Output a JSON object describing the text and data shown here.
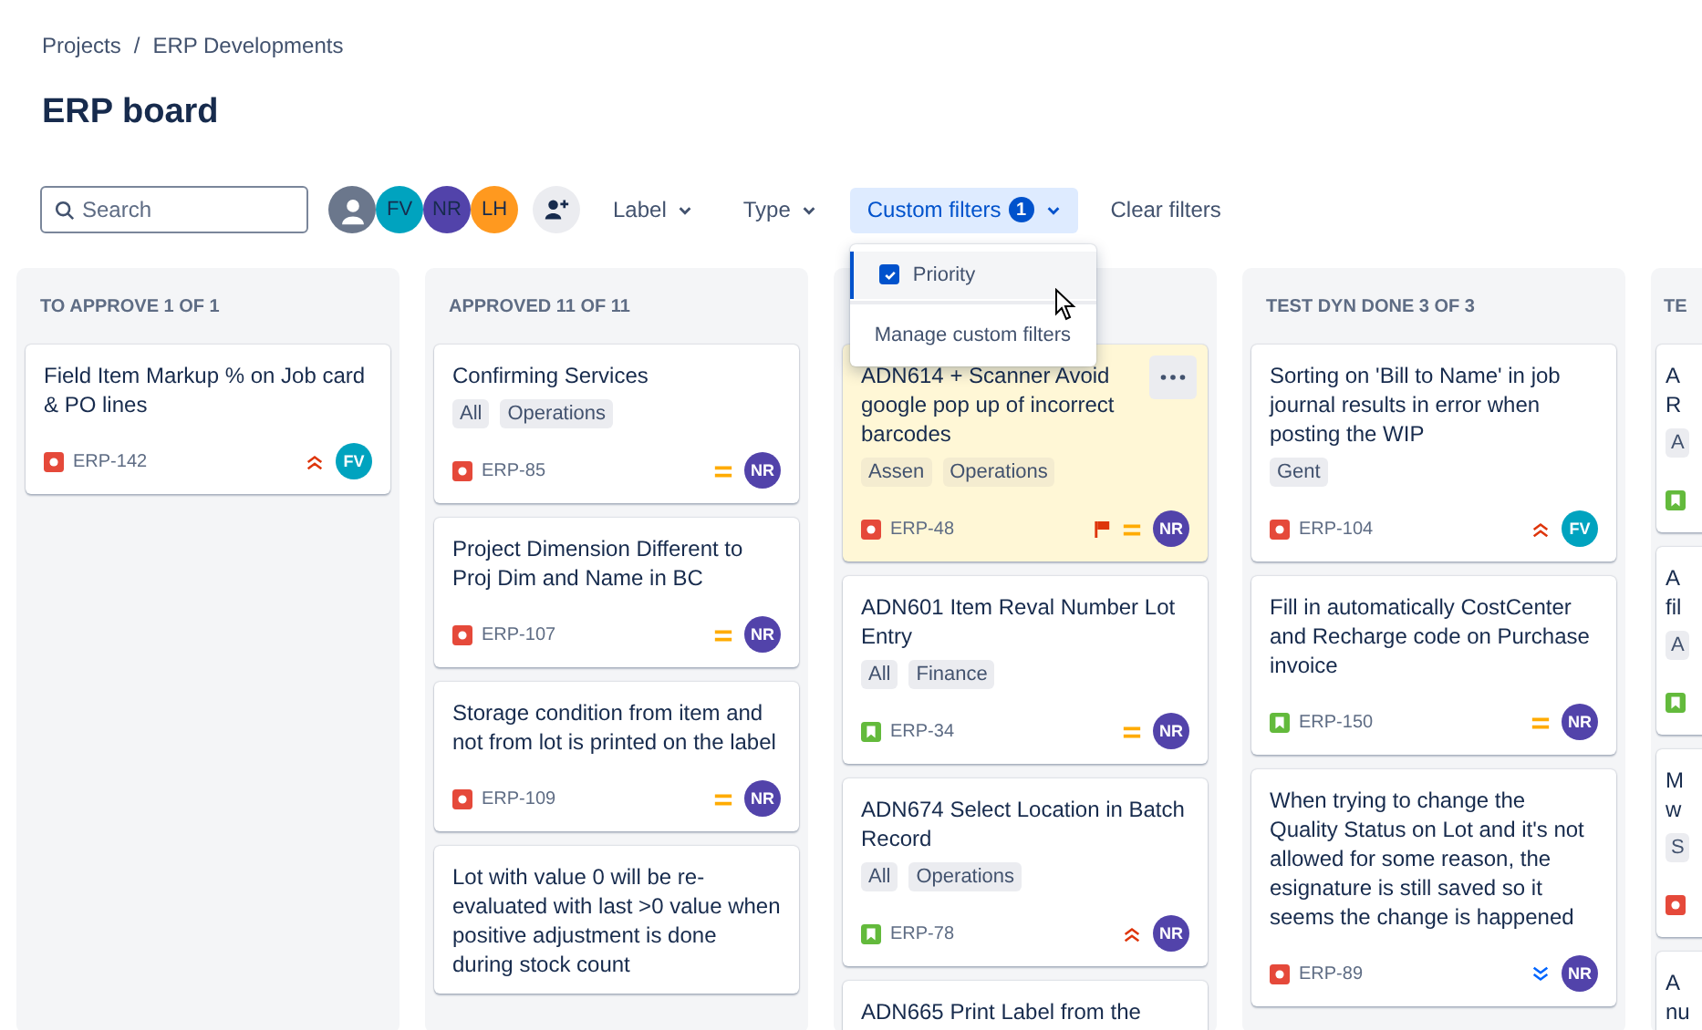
{
  "breadcrumbs": {
    "items": [
      "Projects",
      "ERP Developments"
    ],
    "separator": "/"
  },
  "title": "ERP board",
  "search": {
    "placeholder": "Search"
  },
  "people": [
    {
      "color": "#6b778c",
      "kind": "silhouette"
    },
    {
      "initials": "FV",
      "color": "#00a3bf",
      "kind": "initials"
    },
    {
      "initials": "NR",
      "color": "#5243aa",
      "kind": "initials"
    },
    {
      "initials": "LH",
      "color": "#ff991f",
      "kind": "initials"
    }
  ],
  "filters": [
    {
      "label": "Label",
      "kind": "dropdown",
      "selected": false
    },
    {
      "label": "Type",
      "kind": "dropdown",
      "selected": false
    },
    {
      "label": "Custom filters",
      "kind": "dropdown",
      "selected": true,
      "badge": "1"
    },
    {
      "label": "Clear filters",
      "kind": "plain",
      "selected": false
    }
  ],
  "custom_filters_menu": {
    "items": [
      {
        "label": "Priority",
        "checked": true,
        "selected": true
      }
    ],
    "manage": "Manage custom filters"
  },
  "columns": [
    {
      "header": "TO APPROVE 1 OF 1",
      "cards": [
        {
          "title": "Field Item Markup % on Job card & PO lines",
          "type": {
            "kind": "bug"
          },
          "key": "ERP-142",
          "priority": {
            "kind": "highest"
          },
          "assignee": {
            "initials": "FV",
            "color": "#00a3bf"
          },
          "flagged": false,
          "menu": false
        }
      ]
    },
    {
      "header": "APPROVED 11 OF 11",
      "cards": [
        {
          "title": "Confirming Services",
          "tags": [
            "All",
            "Operations"
          ],
          "type": {
            "kind": "bug"
          },
          "key": "ERP-85",
          "priority": {
            "kind": "medium"
          },
          "assignee": {
            "initials": "NR",
            "color": "#5243aa"
          },
          "flagged": false,
          "menu": false
        },
        {
          "title": "Project Dimension Different to Proj Dim and Name in BC",
          "type": {
            "kind": "bug"
          },
          "key": "ERP-107",
          "priority": {
            "kind": "medium"
          },
          "assignee": {
            "initials": "NR",
            "color": "#5243aa"
          },
          "flagged": false,
          "menu": false
        },
        {
          "title": "Storage condition from item and not from lot is printed on the label",
          "type": {
            "kind": "bug"
          },
          "key": "ERP-109",
          "priority": {
            "kind": "medium"
          },
          "assignee": {
            "initials": "NR",
            "color": "#5243aa"
          },
          "flagged": false,
          "menu": false
        },
        {
          "title": "Lot with value 0 will be re-evaluated with last >0 value when positive adjustment is done during stock count",
          "flagged": false,
          "menu": false
        }
      ]
    },
    {
      "cards": [
        {
          "title": "ADN614 + Scanner Avoid google pop up of incorrect barcodes",
          "tags": [
            "Assen",
            "Operations"
          ],
          "type": {
            "kind": "bug"
          },
          "key": "ERP-48",
          "priority": {
            "kind": "medium"
          },
          "assignee": {
            "initials": "NR",
            "color": "#5243aa"
          },
          "flagged": true,
          "menu": true
        },
        {
          "title": "ADN601 Item Reval Number Lot Entry",
          "tags": [
            "All",
            "Finance"
          ],
          "type": {
            "kind": "story"
          },
          "key": "ERP-34",
          "priority": {
            "kind": "medium"
          },
          "assignee": {
            "initials": "NR",
            "color": "#5243aa"
          },
          "flagged": false,
          "menu": false
        },
        {
          "title": "ADN674 Select Location in Batch Record",
          "tags": [
            "All",
            "Operations"
          ],
          "type": {
            "kind": "story"
          },
          "key": "ERP-78",
          "priority": {
            "kind": "highest"
          },
          "assignee": {
            "initials": "NR",
            "color": "#5243aa"
          },
          "flagged": false,
          "menu": false
        },
        {
          "title": "ADN665 Print Label from the",
          "flagged": false,
          "menu": false
        }
      ]
    },
    {
      "header": "TEST DYN DONE 3 OF 3",
      "cards": [
        {
          "title": "Sorting on 'Bill to Name' in job journal results in error when posting the WIP",
          "tags": [
            "Gent"
          ],
          "type": {
            "kind": "bug"
          },
          "key": "ERP-104",
          "priority": {
            "kind": "highest"
          },
          "assignee": {
            "initials": "FV",
            "color": "#00a3bf"
          },
          "flagged": false,
          "menu": false
        },
        {
          "title": "Fill in automatically CostCenter and Recharge code on Purchase invoice",
          "type": {
            "kind": "story"
          },
          "key": "ERP-150",
          "priority": {
            "kind": "medium"
          },
          "assignee": {
            "initials": "NR",
            "color": "#5243aa"
          },
          "flagged": false,
          "menu": false
        },
        {
          "title": "When trying to change the Quality Status on Lot and it's not allowed for some reason, the esignature is still saved so it seems the change is happened",
          "type": {
            "kind": "bug"
          },
          "key": "ERP-89",
          "priority": {
            "kind": "lowest"
          },
          "assignee": {
            "initials": "NR",
            "color": "#5243aa"
          },
          "flagged": false,
          "menu": false
        }
      ]
    },
    {
      "header": "TE",
      "cards": [
        {
          "title": "A R",
          "tags": [
            "A"
          ],
          "type": {
            "kind": "story"
          },
          "flagged": false,
          "menu": false
        },
        {
          "title": "A fil",
          "tags": [
            "A"
          ],
          "type": {
            "kind": "story"
          },
          "flagged": false,
          "menu": false
        },
        {
          "title": "M w",
          "tags": [
            "S"
          ],
          "type": {
            "kind": "bug"
          },
          "flagged": false,
          "menu": false
        },
        {
          "title": "A nu",
          "flagged": false,
          "menu": false
        }
      ]
    }
  ]
}
